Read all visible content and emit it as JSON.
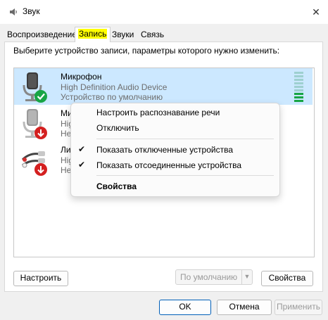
{
  "window": {
    "title": "Звук"
  },
  "tabs": [
    {
      "label": "Воспроизведение"
    },
    {
      "label": "Запись"
    },
    {
      "label": "Звуки"
    },
    {
      "label": "Связь"
    }
  ],
  "instruction": "Выберите устройство записи, параметры которого нужно изменить:",
  "devices": [
    {
      "name": "Микрофон",
      "subtitle": "High Definition Audio Device",
      "status": "Устройство по умолчанию",
      "selected": true,
      "level": 0.3
    },
    {
      "name": "Ми",
      "subtitle": "Hig",
      "status": "Не"
    },
    {
      "name": "Ли",
      "subtitle": "Hig",
      "status": "Не"
    }
  ],
  "context_menu": {
    "items": [
      {
        "label": "Настроить распознавание речи"
      },
      {
        "label": "Отключить"
      },
      {
        "label": "Показать отключенные устройства",
        "checked": true
      },
      {
        "label": "Показать отсоединенные устройства",
        "checked": true
      },
      {
        "label": "Свойства",
        "bold": true
      }
    ],
    "check_glyph": "✔"
  },
  "buttons": {
    "configure": "Настроить",
    "default_split": "По умолчанию",
    "properties": "Свойства",
    "ok": "OK",
    "cancel": "Отмена",
    "apply": "Применить"
  },
  "colors": {
    "selection": "#cce8ff",
    "check_green": "#18a545",
    "disabled_red": "#d42020",
    "highlight": "#ffff00"
  }
}
